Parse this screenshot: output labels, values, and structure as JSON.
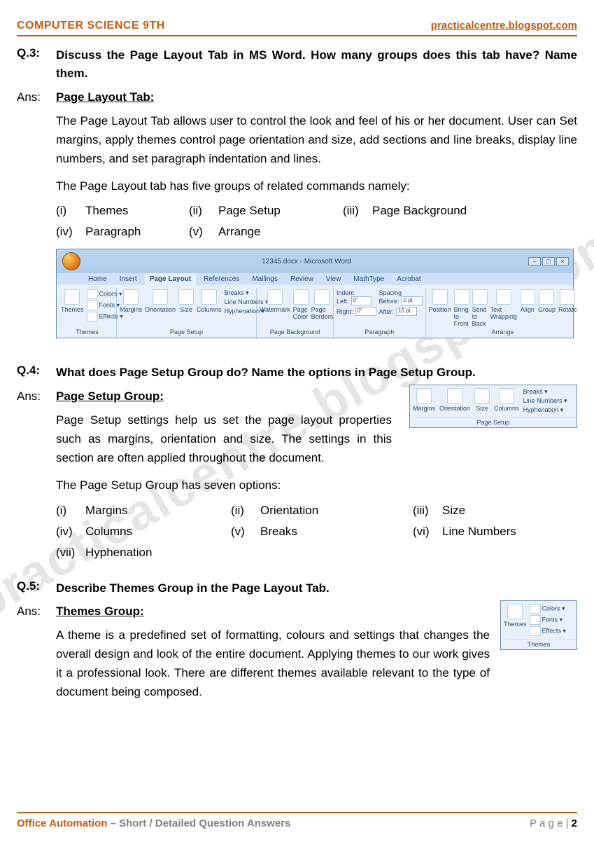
{
  "header": {
    "left": "COMPUTER SCIENCE 9TH",
    "right": "practicalcentre.blogspot.com"
  },
  "watermark": "practicalcentre.blogspot.com",
  "q3": {
    "label": "Q.3:",
    "question": "Discuss the Page Layout Tab in MS Word. How many groups does this tab have? Name them.",
    "ans_label": "Ans:",
    "heading": "Page Layout Tab:",
    "para1": "The Page Layout Tab allows user to control the look and feel of his or her document. User can Set margins, apply themes control page orientation and size, add sections and line breaks, display line numbers, and set paragraph indentation and lines.",
    "para2": "The Page Layout tab has five groups of related commands namely:",
    "groups": [
      {
        "n": "(i)",
        "t": "Themes"
      },
      {
        "n": "(ii)",
        "t": "Page Setup"
      },
      {
        "n": "(iii)",
        "t": "Page Background"
      },
      {
        "n": "(iv)",
        "t": "Paragraph"
      },
      {
        "n": "(v)",
        "t": "Arrange"
      }
    ]
  },
  "ribbon": {
    "doc_title": "12345.docx - Microsoft Word",
    "tabs": [
      "Home",
      "Insert",
      "Page Layout",
      "References",
      "Mailings",
      "Review",
      "View",
      "MathType",
      "Acrobat"
    ],
    "active_tab": "Page Layout",
    "themes": {
      "label": "Themes",
      "btn": "Themes",
      "opts": [
        "Colors ▾",
        "Fonts ▾",
        "Effects ▾"
      ]
    },
    "page_setup": {
      "label": "Page Setup",
      "btns": [
        "Margins",
        "Orientation",
        "Size",
        "Columns"
      ],
      "opts": [
        "Breaks ▾",
        "Line Numbers ▾",
        "Hyphenation ▾"
      ]
    },
    "page_bg": {
      "label": "Page Background",
      "btns": [
        "Watermark",
        "Page Color",
        "Page Borders"
      ]
    },
    "paragraph": {
      "label": "Paragraph",
      "indent": "Indent",
      "spacing": "Spacing",
      "left": "Left:",
      "right": "Right:",
      "before": "Before:",
      "after": "After:",
      "v0": "0\"",
      "v0pt": "0 pt",
      "v10pt": "10 pt"
    },
    "arrange": {
      "label": "Arrange",
      "btns": [
        "Position",
        "Bring to Front",
        "Send to Back",
        "Text Wrapping",
        "Align",
        "Group",
        "Rotate"
      ]
    }
  },
  "q4": {
    "label": "Q.4:",
    "question": "What does Page Setup Group do? Name the options in Page Setup Group.",
    "ans_label": "Ans:",
    "heading": "Page Setup Group:",
    "para1": "Page Setup settings help us set the page layout properties such as margins, orientation and size. The settings in this section are often applied throughout the document.",
    "para2": "The Page Setup Group has seven options:",
    "options": [
      {
        "n": "(i)",
        "t": "Margins"
      },
      {
        "n": "(ii)",
        "t": "Orientation"
      },
      {
        "n": "(iii)",
        "t": "Size"
      },
      {
        "n": "(iv)",
        "t": "Columns"
      },
      {
        "n": "(v)",
        "t": "Breaks"
      },
      {
        "n": "(vi)",
        "t": "Line Numbers"
      },
      {
        "n": "(vii)",
        "t": "Hyphenation"
      }
    ],
    "mini": {
      "label": "Page Setup",
      "btns": [
        "Margins",
        "Orientation",
        "Size",
        "Columns"
      ],
      "opts": [
        "Breaks ▾",
        "Line Numbers ▾",
        "Hyphenation ▾"
      ]
    }
  },
  "q5": {
    "label": "Q.5:",
    "question": "Describe Themes Group in the Page Layout Tab.",
    "ans_label": "Ans:",
    "heading": "Themes Group:",
    "para1": "A theme is a predefined set of formatting, colours and settings that changes the overall design and look of the entire document. Applying themes to our work gives it a professional look. There are different themes available relevant to the type of document being composed.",
    "mini": {
      "label": "Themes",
      "btn": "Themes",
      "opts": [
        "Colors ▾",
        "Fonts ▾",
        "Effects ▾"
      ]
    }
  },
  "footer": {
    "hl": "Office Automation",
    "sep": " – ",
    "gr": "Short / Detailed Question Answers",
    "page_label": "P a g e  | ",
    "page_num": "2"
  }
}
